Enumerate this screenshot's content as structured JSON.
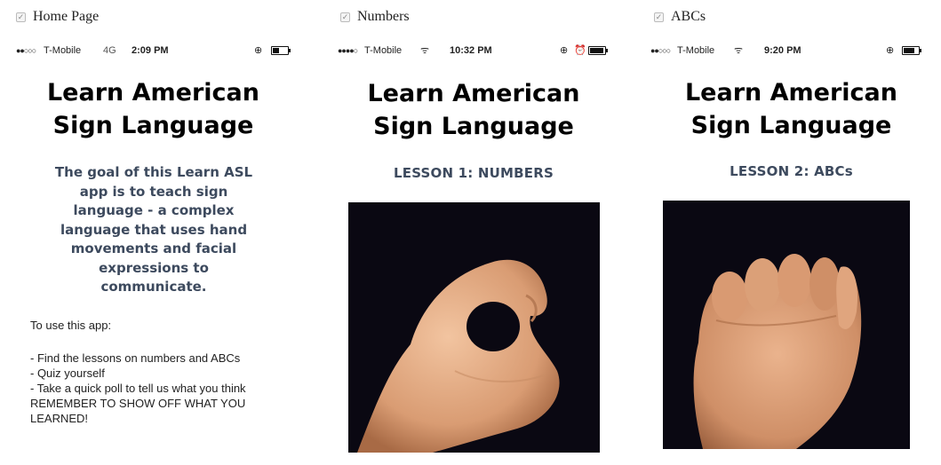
{
  "screens": [
    {
      "caption": "Home Page",
      "status": {
        "carrier": "T-Mobile",
        "network": "4G",
        "time": "2:09 PM"
      },
      "title_line1": "Learn American",
      "title_line2": "Sign Language",
      "goal_text": "The goal of this Learn ASL app is to teach sign language - a complex language that uses hand movements and facial expressions to communicate.",
      "use_heading": "To use this app:",
      "use_body": "- Find the lessons on numbers and ABCs\n- Quiz yourself\n- Take a quick poll to tell us what you think\nREMEMBER TO SHOW OFF WHAT YOU LEARNED!"
    },
    {
      "caption": "Numbers",
      "status": {
        "carrier": "T-Mobile",
        "time": "10:32 PM"
      },
      "title_line1": "Learn American",
      "title_line2": "Sign Language",
      "lesson": "LESSON 1: NUMBERS"
    },
    {
      "caption": "ABCs",
      "status": {
        "carrier": "T-Mobile",
        "time": "9:20 PM"
      },
      "title_line1": "Learn American",
      "title_line2": "Sign Language",
      "lesson": "LESSON 2: ABCs"
    }
  ],
  "icons": {
    "checkbox": "check-icon",
    "wifi": "wifi-icon",
    "lock": "rotation-lock-icon",
    "alarm": "alarm-icon",
    "battery": "battery-icon"
  },
  "colors": {
    "subtitle": "#3d4a5e",
    "photo_bg": "#0a0812",
    "skin": "#e8b48f"
  }
}
